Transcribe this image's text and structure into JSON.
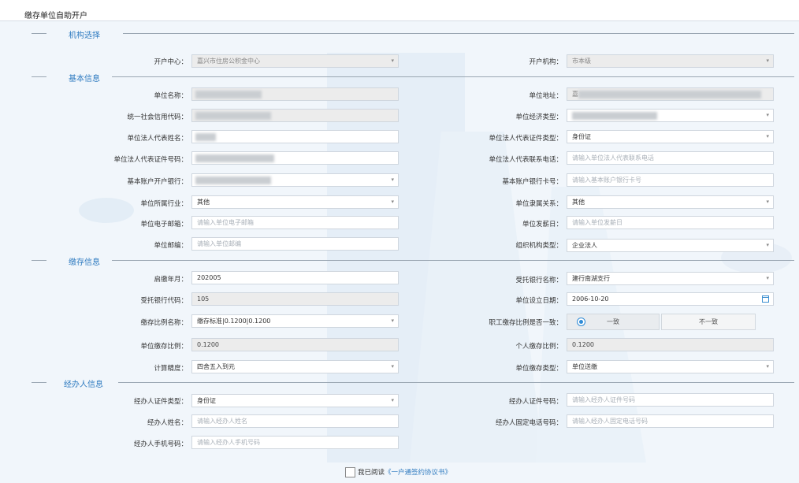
{
  "page": {
    "title": "缴存单位自助开户"
  },
  "sections": {
    "org": "机构选择",
    "basic": "基本信息",
    "deposit": "缴存信息",
    "agent": "经办人信息"
  },
  "org": {
    "center_label": "开户中心：",
    "center_value": "嘉兴市住房公积金中心",
    "inst_label": "开户机构：",
    "inst_value": "市本级"
  },
  "basic": {
    "name_label": "单位名称：",
    "address_label": "单位地址：",
    "address_prefix": "嘉",
    "credit_label": "统一社会信用代码：",
    "econ_label": "单位经济类型：",
    "legal_name_label": "单位法人代表姓名：",
    "legal_idtype_label": "单位法人代表证件类型：",
    "legal_idtype_value": "身份证",
    "legal_idno_label": "单位法人代表证件号码：",
    "legal_phone_label": "单位法人代表联系电话：",
    "legal_phone_ph": "请输入单位法人代表联系电话",
    "bank_label": "基本账户开户银行：",
    "bank_card_label": "基本账户银行卡号：",
    "bank_card_ph": "请输入基本账户银行卡号",
    "industry_label": "单位所属行业：",
    "industry_value": "其他",
    "relation_label": "单位隶属关系：",
    "relation_value": "其他",
    "email_label": "单位电子邮箱：",
    "email_ph": "请输入单位电子邮箱",
    "payday_label": "单位发薪日：",
    "payday_ph": "请输入单位发薪日",
    "zip_label": "单位邮编：",
    "zip_ph": "请输入单位邮编",
    "orgtype_label": "组织机构类型：",
    "orgtype_value": "企业法人"
  },
  "deposit": {
    "start_label": "启缴年月：",
    "start_value": "202005",
    "trust_bank_label": "受托银行名称：",
    "trust_bank_value": "建行南湖支行",
    "trust_code_label": "受托银行代码：",
    "trust_code_value": "105",
    "setup_date_label": "单位设立日期：",
    "setup_date_value": "2006-10-20",
    "ratio_name_label": "缴存比例名称：",
    "ratio_name_value": "缴存标准|0.1200|0.1200",
    "consistent_label": "职工缴存比例是否一致：",
    "opt_yes": "一致",
    "opt_no": "不一致",
    "unit_ratio_label": "单位缴存比例：",
    "unit_ratio_value": "0.1200",
    "personal_ratio_label": "个人缴存比例：",
    "personal_ratio_value": "0.1200",
    "precision_label": "计算精度：",
    "precision_value": "四舍五入到元",
    "deposit_type_label": "单位缴存类型：",
    "deposit_type_value": "单位送缴"
  },
  "agent": {
    "idtype_label": "经办人证件类型：",
    "idtype_value": "身份证",
    "idno_label": "经办人证件号码：",
    "idno_ph": "请输入经办人证件号码",
    "name_label": "经办人姓名：",
    "name_ph": "请输入经办人姓名",
    "tel_label": "经办人固定电话号码：",
    "tel_ph": "请输入经办人固定电话号码",
    "mobile_label": "经办人手机号码：",
    "mobile_ph": "请输入经办人手机号码"
  },
  "agreement": {
    "text": "我已阅读",
    "link": "《一户通签约协议书》"
  },
  "icons": {
    "dropdown": "chevron-down-icon",
    "calendar": "calendar-icon",
    "radio": "radio-selected-icon"
  },
  "colors": {
    "accent": "#2f7bc0",
    "background": "#f1f6fb"
  }
}
